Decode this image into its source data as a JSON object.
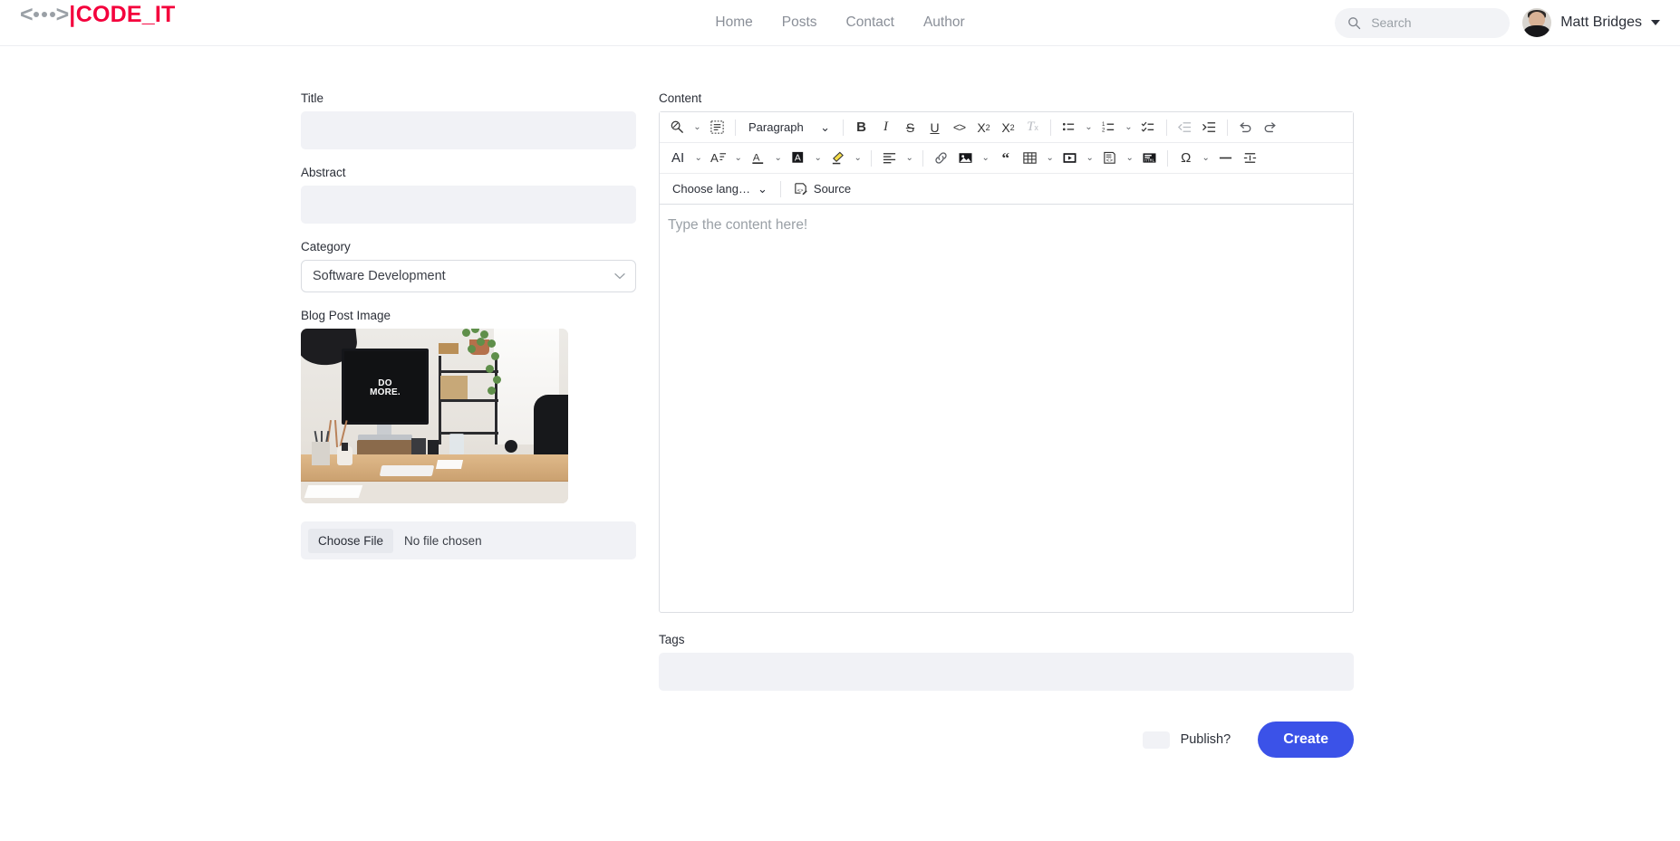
{
  "brand": {
    "chevron_left": "<",
    "chevron_right": ">",
    "bar": "|",
    "name": "CODE_IT",
    "accent_color": "#f4003c"
  },
  "nav": {
    "items": [
      {
        "label": "Home"
      },
      {
        "label": "Posts"
      },
      {
        "label": "Contact"
      },
      {
        "label": "Author"
      }
    ]
  },
  "search": {
    "placeholder": "Search",
    "value": "",
    "icon": "search-icon"
  },
  "user": {
    "name": "Matt Bridges",
    "caret": "caret-down-icon",
    "avatar": "avatar"
  },
  "form": {
    "title": {
      "label": "Title",
      "value": "",
      "placeholder": ""
    },
    "abstract": {
      "label": "Abstract",
      "value": "",
      "placeholder": ""
    },
    "category": {
      "label": "Category",
      "selected": "Software Development",
      "caret": "chevron-down-icon"
    },
    "image": {
      "label": "Blog Post Image",
      "preview_alt": "desk with iMac displaying DO MORE.",
      "screen_line1": "DO",
      "screen_line2": "MORE.",
      "choose_file_label": "Choose File",
      "file_status": "No file chosen"
    },
    "tags": {
      "label": "Tags",
      "value": "",
      "placeholder": ""
    },
    "publish": {
      "label": "Publish?",
      "checked": false
    },
    "submit": {
      "label": "Create",
      "color": "#3b52e8"
    }
  },
  "content": {
    "label": "Content",
    "placeholder": "Type the content here!",
    "value": ""
  },
  "toolbar": {
    "row1": [
      {
        "name": "find-and-replace-icon",
        "glyph": "",
        "type": "icon-caret"
      },
      {
        "name": "select-all-icon",
        "glyph": "",
        "type": "icon"
      },
      {
        "name": "separator",
        "type": "sep"
      },
      {
        "name": "paragraph-style-dropdown",
        "label": "Paragraph",
        "type": "dropdown"
      },
      {
        "name": "separator",
        "type": "sep"
      },
      {
        "name": "bold-icon",
        "glyph": "B",
        "type": "icon"
      },
      {
        "name": "italic-icon",
        "glyph": "I",
        "type": "icon"
      },
      {
        "name": "strikethrough-icon",
        "glyph": "S",
        "type": "icon"
      },
      {
        "name": "underline-icon",
        "glyph": "U",
        "type": "icon"
      },
      {
        "name": "inline-code-icon",
        "glyph": "<>",
        "type": "icon"
      },
      {
        "name": "subscript-icon",
        "glyph": "X",
        "type": "icon"
      },
      {
        "name": "superscript-icon",
        "glyph": "X",
        "type": "icon"
      },
      {
        "name": "remove-format-icon",
        "glyph": "T",
        "type": "icon"
      },
      {
        "name": "separator",
        "type": "sep"
      },
      {
        "name": "bulleted-list-icon",
        "type": "icon-caret"
      },
      {
        "name": "numbered-list-icon",
        "type": "icon-caret"
      },
      {
        "name": "todo-list-icon",
        "type": "icon"
      },
      {
        "name": "separator",
        "type": "sep"
      },
      {
        "name": "outdent-icon",
        "type": "icon"
      },
      {
        "name": "indent-icon",
        "type": "icon"
      },
      {
        "name": "separator",
        "type": "sep"
      },
      {
        "name": "undo-icon",
        "type": "icon"
      },
      {
        "name": "redo-icon",
        "type": "icon"
      }
    ],
    "row2": [
      {
        "name": "ai-assistant-dropdown",
        "label": "AI",
        "type": "text-caret"
      },
      {
        "name": "font-size-icon",
        "type": "icon-caret"
      },
      {
        "name": "font-color-icon",
        "type": "icon-caret"
      },
      {
        "name": "font-background-color-icon",
        "type": "icon-caret"
      },
      {
        "name": "highlight-icon",
        "type": "icon-caret"
      },
      {
        "name": "separator",
        "type": "sep"
      },
      {
        "name": "text-alignment-icon",
        "type": "icon-caret"
      },
      {
        "name": "separator",
        "type": "sep"
      },
      {
        "name": "link-icon",
        "type": "icon"
      },
      {
        "name": "insert-image-icon",
        "type": "icon-caret"
      },
      {
        "name": "blockquote-icon",
        "type": "icon"
      },
      {
        "name": "insert-table-icon",
        "type": "icon-caret"
      },
      {
        "name": "media-embed-icon",
        "type": "icon-caret"
      },
      {
        "name": "code-block-icon",
        "type": "icon-caret"
      },
      {
        "name": "html-embed-icon",
        "type": "icon"
      },
      {
        "name": "separator",
        "type": "sep"
      },
      {
        "name": "special-characters-icon",
        "glyph": "Ω",
        "type": "icon-caret"
      },
      {
        "name": "horizontal-line-icon",
        "type": "icon"
      },
      {
        "name": "page-break-icon",
        "type": "icon"
      }
    ],
    "row3": {
      "language_dropdown": {
        "label": "Choose lang…"
      },
      "source_button": {
        "label": "Source",
        "icon": "source-code-icon"
      }
    }
  }
}
